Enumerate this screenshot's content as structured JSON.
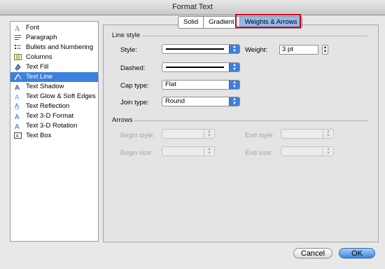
{
  "window": {
    "title": "Format Text"
  },
  "sidebar": {
    "items": [
      {
        "label": "Font",
        "icon": "font-icon",
        "selected": false
      },
      {
        "label": "Paragraph",
        "icon": "paragraph-icon",
        "selected": false
      },
      {
        "label": "Bullets and Numbering",
        "icon": "bullets-icon",
        "selected": false
      },
      {
        "label": "Columns",
        "icon": "columns-icon",
        "selected": false
      },
      {
        "label": "Text Fill",
        "icon": "text-fill-icon",
        "selected": false
      },
      {
        "label": "Text Line",
        "icon": "text-line-icon",
        "selected": true
      },
      {
        "label": "Text Shadow",
        "icon": "text-shadow-icon",
        "selected": false
      },
      {
        "label": "Text Glow & Soft Edges",
        "icon": "text-glow-icon",
        "selected": false
      },
      {
        "label": "Text Reflection",
        "icon": "text-reflection-icon",
        "selected": false
      },
      {
        "label": "Text 3-D Format",
        "icon": "text-3d-format-icon",
        "selected": false
      },
      {
        "label": "Text 3-D Rotation",
        "icon": "text-3d-rotation-icon",
        "selected": false
      },
      {
        "label": "Text Box",
        "icon": "text-box-icon",
        "selected": false
      }
    ]
  },
  "tabs": {
    "items": [
      {
        "label": "Solid",
        "active": false
      },
      {
        "label": "Gradient",
        "active": false
      },
      {
        "label": "Weights & Arrows",
        "active": true
      }
    ]
  },
  "line_style": {
    "title": "Line style",
    "style_label": "Style:",
    "dashed_label": "Dashed:",
    "weight_label": "Weight:",
    "weight_value": "3 pt",
    "cap_type_label": "Cap type:",
    "cap_type_value": "Flat",
    "join_type_label": "Join type:",
    "join_type_value": "Round"
  },
  "arrows": {
    "title": "Arrows",
    "begin_style_label": "Begin style:",
    "end_style_label": "End style:",
    "begin_size_label": "Begin size:",
    "end_size_label": "End size:"
  },
  "footer": {
    "cancel_label": "Cancel",
    "ok_label": "OK"
  },
  "colors": {
    "accent": "#3d80df",
    "highlight_border": "#d0001b"
  }
}
